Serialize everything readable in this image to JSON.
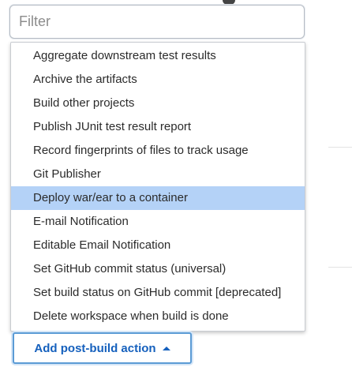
{
  "filter": {
    "placeholder": "Filter",
    "value": ""
  },
  "menu": {
    "items": [
      {
        "label": "Aggregate downstream test results"
      },
      {
        "label": "Archive the artifacts"
      },
      {
        "label": "Build other projects"
      },
      {
        "label": "Publish JUnit test result report"
      },
      {
        "label": "Record fingerprints of files to track usage"
      },
      {
        "label": "Git Publisher"
      },
      {
        "label": "Deploy war/ear to a container"
      },
      {
        "label": "E-mail Notification"
      },
      {
        "label": "Editable Email Notification"
      },
      {
        "label": "Set GitHub commit status (universal)"
      },
      {
        "label": "Set build status on GitHub commit [deprecated]"
      },
      {
        "label": "Delete workspace when build is done"
      }
    ],
    "highlighted_index": 6,
    "highlight_color": "#b4d2f7"
  },
  "action_button": {
    "label": "Add post-build action",
    "icon": "caret-up-icon",
    "accent_color": "#1560bd"
  }
}
